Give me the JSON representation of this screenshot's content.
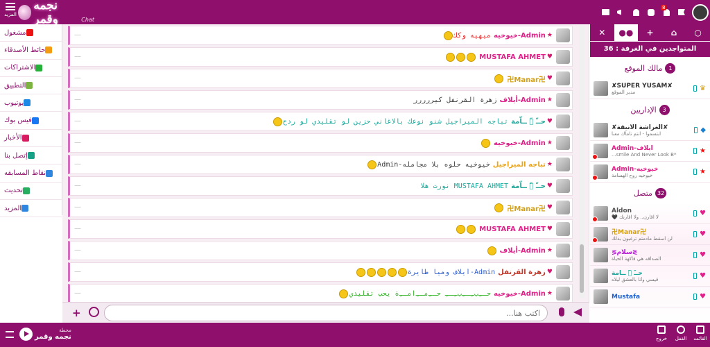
{
  "topbar": {
    "more_label": "المزيد",
    "logo_text": "نجمه وقمر",
    "logo_tag": "Chat",
    "notif_count": "8",
    "icons": [
      "flag-icon",
      "notification-icon",
      "user-icon",
      "user-icon",
      "puzzle-icon",
      "megaphone-icon",
      "mail-icon"
    ]
  },
  "menu": [
    {
      "label": "مشغول",
      "icon": "busy-icon",
      "color": "#e11"
    },
    {
      "label": "حائط الأصدقاء",
      "icon": "rss-icon",
      "color": "#f39c12"
    },
    {
      "label": "الاشتراكات",
      "icon": "whatsapp-icon",
      "color": "#25b03a"
    },
    {
      "label": "التطبيق",
      "icon": "android-icon",
      "color": "#7cb342"
    },
    {
      "label": "يوتيوب",
      "icon": "youtube-icon",
      "color": "#1e88e5"
    },
    {
      "label": "فيس بوك",
      "icon": "facebook-icon",
      "color": "#1877f2"
    },
    {
      "label": "الأخبار",
      "icon": "news-icon",
      "color": "#d81b60"
    },
    {
      "label": "إتصل بنا",
      "icon": "envelope-icon",
      "color": "#16a085"
    },
    {
      "label": "نقاط المسابقه",
      "icon": "question-icon",
      "color": "#2e86de"
    },
    {
      "label": "تحديث",
      "icon": "refresh-icon",
      "color": "#27ae60"
    },
    {
      "label": "المزيد",
      "icon": "plus-icon",
      "color": "#2e86de"
    }
  ],
  "messages": [
    {
      "name": "Admin-خيوخيه",
      "name_color": "#e0218a",
      "mark": "★",
      "text": "ميهيه وكك",
      "text_color": "#e22",
      "emojis": 1
    },
    {
      "name": "MUSTAFA AHMET",
      "name_color": "#e0218a",
      "mark": "♥",
      "text": "",
      "text_color": "#333",
      "emojis": 3
    },
    {
      "name": "卍Manar卍",
      "name_color": "#d4a017",
      "mark": "♥",
      "text": "",
      "text_color": "#333",
      "emojis": 1
    },
    {
      "name": "Admin-أيلاف",
      "name_color": "#e0218a",
      "mark": "★",
      "text": "زهرة القرنفل كيررررر",
      "text_color": "#444",
      "emojis": 0
    },
    {
      "name": "حــّ ﹏ّ ــاّمة",
      "name_color": "#1aa79a",
      "mark": "♥",
      "text": "تباجه الميراجيل شنو نوعك بالاغاني حزين لو تقليدي لو ردح",
      "text_color": "#1aa79a",
      "emojis": 1
    },
    {
      "name": "Admin-خيوخيه",
      "name_color": "#e0218a",
      "mark": "★",
      "text": "",
      "text_color": "#333",
      "emojis": 1
    },
    {
      "name": "تباجه الميراجيل",
      "name_color": "#e8a317",
      "mark": "★",
      "text": "خيوخيه حلوه بلا مجامله-Admin",
      "text_color": "#444",
      "emojis": 1
    },
    {
      "name": "حــّ ﹏ّ ــاّمة",
      "name_color": "#1aa79a",
      "mark": "♥",
      "text": "MUSTAFA AHMET نورت هلا",
      "text_color": "#1aa79a",
      "emojis": 0
    },
    {
      "name": "卍Manar卍",
      "name_color": "#d4a017",
      "mark": "♥",
      "text": "",
      "text_color": "#333",
      "emojis": 1
    },
    {
      "name": "MUSTAFA AHMET",
      "name_color": "#e0218a",
      "mark": "♥",
      "text": "",
      "text_color": "#333",
      "emojis": 2
    },
    {
      "name": "Admin-أيلاف",
      "name_color": "#e0218a",
      "mark": "★",
      "text": "",
      "text_color": "#333",
      "emojis": 1
    },
    {
      "name": "زهرة القرنفل",
      "name_color": "#c0392b",
      "mark": "♥",
      "text": "Admin-أيلاف وميا طايرة",
      "text_color": "#2e5fd1",
      "emojis": 5
    },
    {
      "name": "Admin-خيوخيه",
      "name_color": "#e0218a",
      "mark": "★",
      "text": "حـﹻبﹻـﹻبﹻـﹻ حـﹻمـﹻامـﹻة يحب تقليدي",
      "text_color": "#2bb11f",
      "emojis": 1
    }
  ],
  "input": {
    "placeholder": "اكتب هنا..."
  },
  "rightpanel": {
    "online_count_label": "المتواجدين في الغرفة : 36",
    "sections": {
      "owner": {
        "label": "مالك الموقع",
        "count": "1"
      },
      "admins": {
        "label": "الإداريين",
        "count": "3"
      },
      "online": {
        "label": "متصل",
        "count": "32"
      }
    },
    "owner_user": {
      "name": "✘SUPER YUSAM✘",
      "status": "مدير الموقع",
      "name_color": "#333"
    },
    "admin_users": [
      {
        "name": "✘الغراشة الأنيقة✘",
        "status": "ابتسموا - انتم ناماك معنا",
        "name_color": "#333",
        "banned": false
      },
      {
        "name": "Admin-أيلاف",
        "status": "*smile And Never Look B...",
        "name_color": "#e0218a",
        "banned": true
      },
      {
        "name": "Admin-خيوخيه",
        "status": "خيوخيه روح الهسامة",
        "name_color": "#e0218a",
        "banned": true
      }
    ],
    "online_users": [
      {
        "name": "Aldon",
        "status": "لا اقارن.. ولا اقارنك 🖤",
        "name_color": "#555",
        "banned": true
      },
      {
        "name": "卍Manar卍",
        "status": "لن اسقط مادمتم ترغبون بذلك",
        "name_color": "#d4a017",
        "banned": true
      },
      {
        "name": "≶سلام≷",
        "status": "الصداقه هي فاكهة الحياة",
        "name_color": "#b516d6",
        "banned": false
      },
      {
        "name": "حــّ ﹏ّ ــاّمة",
        "status": "قيسي وأنا بالعشق ليلاه",
        "name_color": "#1aa79a",
        "banned": false
      },
      {
        "name": "Mustafa",
        "status": "",
        "name_color": "#1a5fd1",
        "banned": false
      }
    ]
  },
  "bottombar": {
    "station_caption": "محطة",
    "station_name": "نجمه وقمر",
    "buttons": [
      "خروج",
      "القفل",
      "القائمه"
    ]
  }
}
